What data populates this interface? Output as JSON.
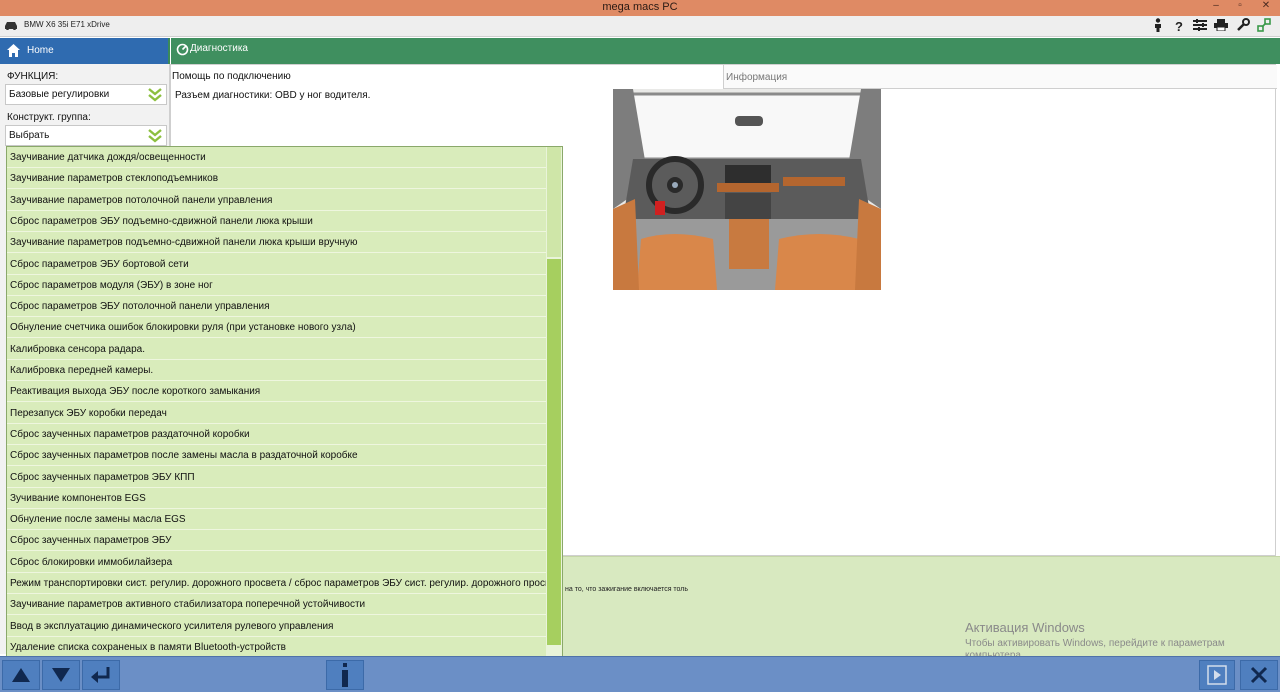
{
  "window": {
    "title": "mega macs PC"
  },
  "vehicle": {
    "name": "BMW X6 35i E71 xDrive"
  },
  "tabs": {
    "home": "Home",
    "diagnostics": "Диагностика"
  },
  "left": {
    "function_label": "ФУНКЦИЯ:",
    "function_value": "Базовые регулировки",
    "group_label": "Конструкт. группа:",
    "group_value": "Выбрать"
  },
  "main": {
    "help_title": "Помощь по подключению",
    "info_tab": "Информация",
    "help_text": "Разъем диагностики: OBD у ног водителя."
  },
  "status": {
    "text": "на то, что зажигание включается толь"
  },
  "watermark": {
    "line1": "Активация Windows",
    "line2": "Чтобы активировать Windows, перейдите к параметрам",
    "line3": "компьютера."
  },
  "function_list": [
    "Заучивание датчика дождя/освещенности",
    "Заучивание параметров стеклоподъемников",
    "Заучивание параметров потолочной панели управления",
    "Сброс параметров ЭБУ подъемно-сдвижной панели люка крыши",
    "Заучивание параметров подъемно-сдвижной панели люка крыши вручную",
    "Сброс параметров ЭБУ бортовой сети",
    "Сброс параметров модуля (ЭБУ) в зоне ног",
    "Сброс параметров ЭБУ потолочной панели управления",
    "Обнуление счетчика ошибок блокировки руля (при установке нового узла)",
    "Калибровка сенсора радара.",
    "Калибровка передней камеры.",
    "Реактивация выхода ЭБУ после короткого замыкания",
    "Перезапуск ЭБУ коробки передач",
    "Сброс заученных параметров раздаточной коробки",
    "Сброс заученных параметров после замены масла в раздаточной коробке",
    "Сброс заученных параметров ЭБУ КПП",
    "Зучивание компонентов EGS",
    "Обнуление после замены масла EGS",
    "Сброс заученных параметров ЭБУ",
    "Сброс блокировки иммобилайзера",
    "Режим транспортировки сист. регулир. дорожного просвета / сброс параметров ЭБУ сист. регулир. дорожного просвета",
    "Заучивание параметров активного стабилизатора поперечной устойчивости",
    "Ввод в эксплуатацию динамического усилителя рулевого управления",
    "Удаление списка сохраненых в памяти Bluetooth-устройств"
  ],
  "colors": {
    "titlebar": "#df8a64",
    "home_tab": "#2f6bb0",
    "diag_tab": "#3f8f5f",
    "list_bg": "#d9ecbb",
    "scroll_thumb": "#a6cf5f",
    "bottom_bar": "#6b8fc6"
  },
  "icons": {
    "home": "home-icon",
    "diagnostics": "diagnostics-icon",
    "help": "question-icon",
    "person": "person-icon",
    "print": "printer-icon",
    "tool": "wrench-icon",
    "connection": "connection-icon",
    "settings": "settings-list-icon",
    "up": "arrow-up-icon",
    "down": "arrow-down-icon",
    "enter": "enter-icon",
    "info": "info-icon",
    "play": "play-icon",
    "close": "close-icon",
    "chevron": "chevron-double-down-icon"
  }
}
